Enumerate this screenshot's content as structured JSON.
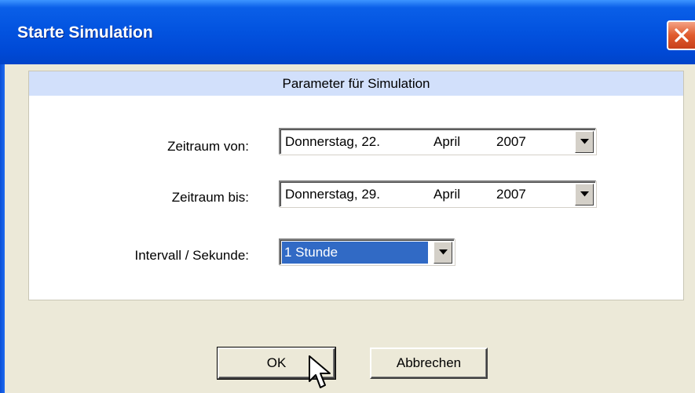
{
  "window": {
    "title": "Starte Simulation"
  },
  "panel": {
    "header": "Parameter für Simulation"
  },
  "fields": {
    "from": {
      "label": "Zeitraum von:",
      "weekday": "Donnerstag, 22.",
      "month": "April",
      "year": "2007"
    },
    "to": {
      "label": "Zeitraum bis:",
      "weekday": "Donnerstag, 29.",
      "month": "April",
      "year": "2007"
    },
    "interval": {
      "label": "Intervall / Sekunde:",
      "value": "1 Stunde"
    }
  },
  "buttons": {
    "ok": "OK",
    "cancel": "Abbrechen"
  },
  "colors": {
    "titlebar": "#0354e0",
    "panel_header": "#d2e0fb",
    "selection": "#316ac5",
    "dialog_bg": "#ece9d8"
  },
  "icons": {
    "close": "close-icon",
    "dropdown": "chevron-down-icon",
    "cursor": "mouse-pointer-icon"
  }
}
